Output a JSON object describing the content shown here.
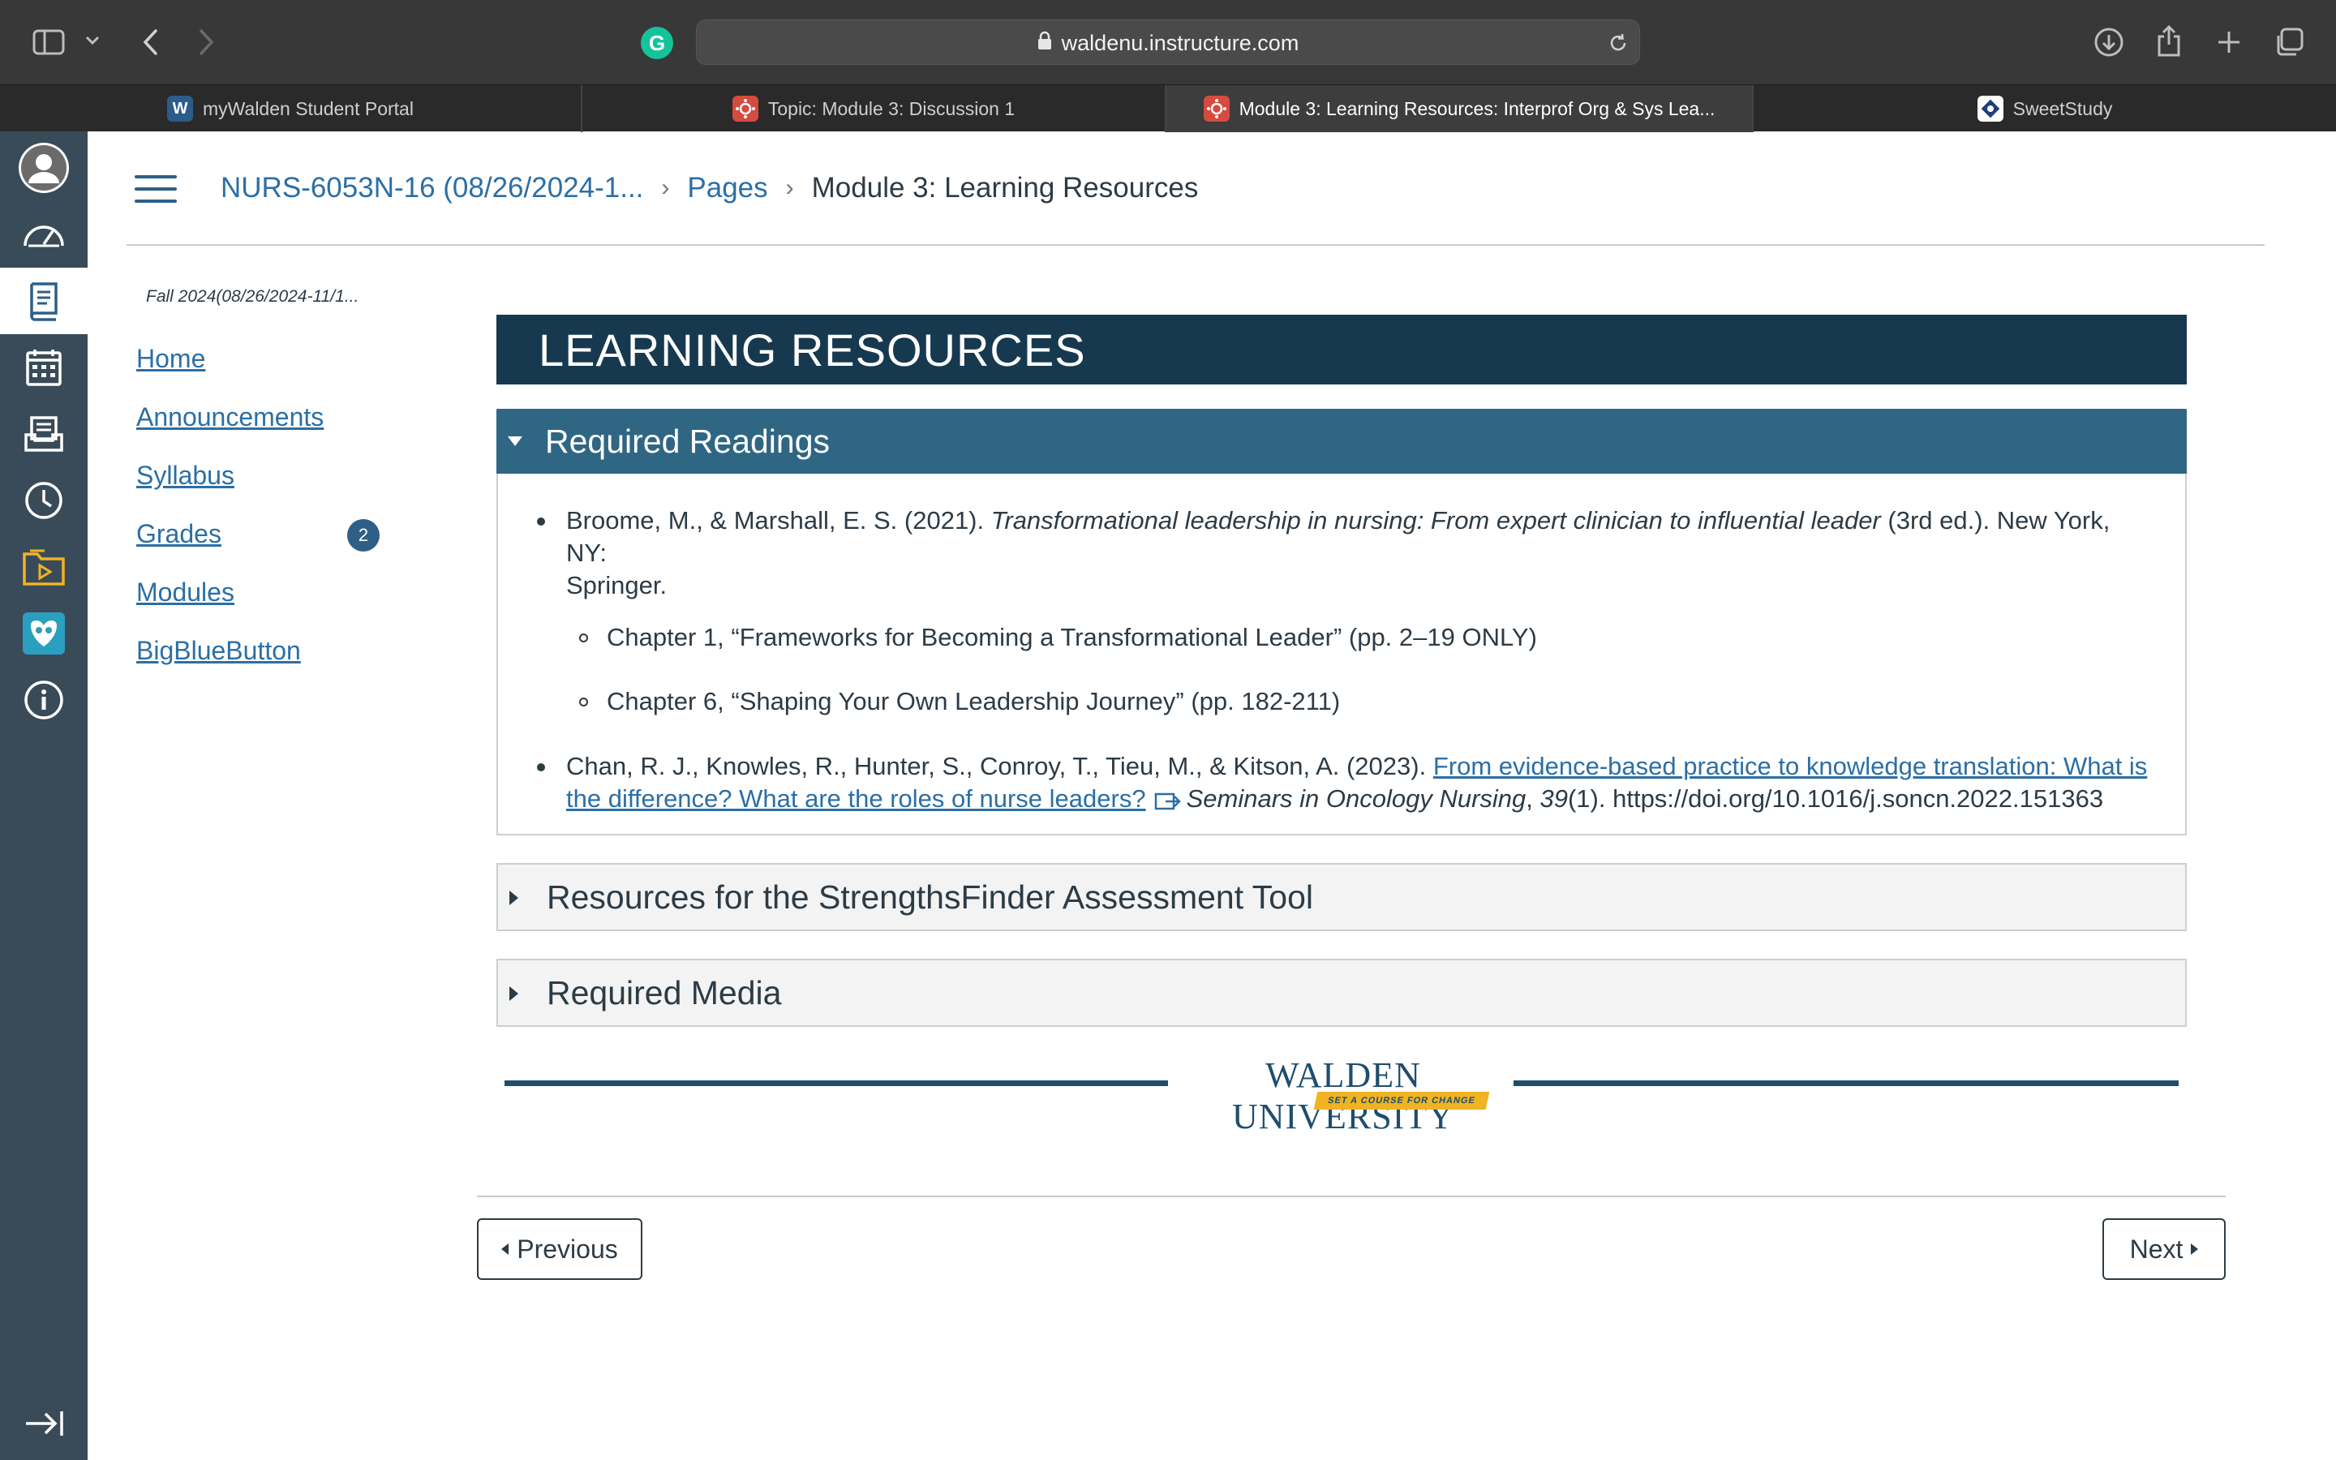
{
  "browser": {
    "url": "waldenu.instructure.com",
    "icons": [
      "sidebar-icon",
      "chevron-down-icon",
      "back-icon",
      "forward-icon",
      "grammarly-icon",
      "lock-icon",
      "reload-icon",
      "download-icon",
      "share-icon",
      "new-tab-icon",
      "tab-overview-icon"
    ],
    "grammarly_letter": "G"
  },
  "tabs": [
    {
      "label": "myWalden Student Portal",
      "favicon": "W",
      "active": false
    },
    {
      "label": "Topic: Module 3: Discussion 1",
      "favicon": "canvas",
      "active": false
    },
    {
      "label": "Module 3: Learning Resources: Interprof Org & Sys Lea...",
      "favicon": "canvas",
      "active": true
    },
    {
      "label": "SweetStudy",
      "favicon": "sweetstudy",
      "active": false
    }
  ],
  "global_nav": {
    "items": [
      "account-icon",
      "dashboard-icon",
      "courses-icon",
      "calendar-icon",
      "inbox-icon",
      "history-icon",
      "files-icon",
      "studio-icon",
      "help-icon"
    ],
    "active": "courses-icon",
    "collapse": "collapse-nav-icon"
  },
  "breadcrumb": {
    "course": "NURS-6053N-16 (08/26/2024-1...",
    "section": "Pages",
    "current": "Module 3: Learning Resources"
  },
  "course_nav": {
    "term": "Fall 2024(08/26/2024-11/1...",
    "links": [
      "Home",
      "Announcements",
      "Syllabus",
      "Grades",
      "Modules",
      "BigBlueButton"
    ],
    "grades_badge": "2"
  },
  "content": {
    "banner": "LEARNING RESOURCES",
    "accordions": [
      {
        "title": "Required Readings",
        "expanded": true
      },
      {
        "title": "Resources for the StrengthsFinder Assessment Tool",
        "expanded": false
      },
      {
        "title": "Required Media",
        "expanded": false
      }
    ],
    "reading1": {
      "authors": "Broome, M., & Marshall, E. S. (2021). ",
      "title": "Transformational leadership in nursing: From expert clinician to influential leader",
      "rest_line1": " (3rd ed.). New York, NY:",
      "rest_line2": "Springer.",
      "chapters": [
        "Chapter 1, “Frameworks for Becoming a Transformational Leader” (pp. 2–19 ONLY)",
        "Chapter 6, “Shaping Your Own Leadership Journey” (pp. 182-211)"
      ]
    },
    "reading2": {
      "authors": "Chan, R. J., Knowles, R., Hunter, S., Conroy, T., Tieu, M., & Kitson, A. (2023). ",
      "link_line1": "From evidence-based practice to knowledge translation: What is",
      "link_line2": "the difference? What are the roles of nurse leaders?",
      "journal": "Seminars in Oncology Nursing",
      "sep": ", ",
      "volume": "39",
      "issue_doi": "(1). https://doi.org/10.1016/j.soncn.2022.151363"
    }
  },
  "logo": {
    "name": "WALDEN UNIVERSITY",
    "tagline": "SET A COURSE FOR CHANGE"
  },
  "pager": {
    "previous": "Previous",
    "next": "Next"
  },
  "colors": {
    "banner": "#17394f",
    "accordion_open": "#2f6683",
    "link": "#2b6fa6",
    "global_nav": "#394b58",
    "logo_gold": "#f0b323"
  }
}
